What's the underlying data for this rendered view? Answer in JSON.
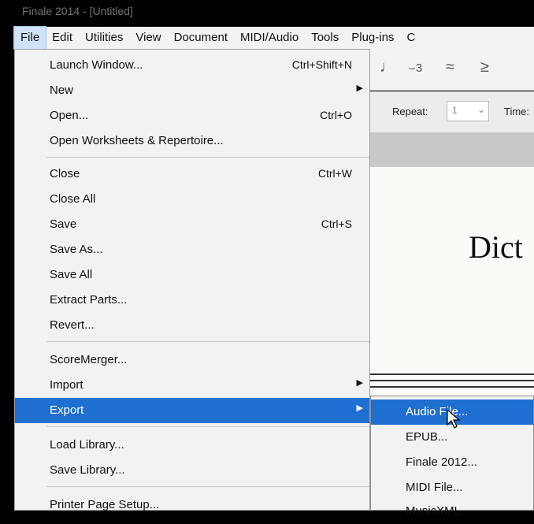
{
  "window": {
    "title": "Finale 2014 - [Untitled]"
  },
  "menubar": {
    "items": [
      "File",
      "Edit",
      "Utilities",
      "View",
      "Document",
      "MIDI/Audio",
      "Tools",
      "Plug-ins",
      "C"
    ]
  },
  "toolbar": {
    "repeat_label": "Repeat:",
    "repeat_value": "1",
    "time_label": "Time:"
  },
  "document": {
    "title_fragment": "Dict"
  },
  "file_menu": {
    "launch_window": {
      "label": "Launch Window...",
      "shortcut": "Ctrl+Shift+N"
    },
    "new": {
      "label": "New"
    },
    "open": {
      "label": "Open...",
      "shortcut": "Ctrl+O"
    },
    "open_worksheets": {
      "label": "Open Worksheets & Repertoire..."
    },
    "close": {
      "label": "Close",
      "shortcut": "Ctrl+W"
    },
    "close_all": {
      "label": "Close All"
    },
    "save": {
      "label": "Save",
      "shortcut": "Ctrl+S"
    },
    "save_as": {
      "label": "Save As..."
    },
    "save_all": {
      "label": "Save All"
    },
    "extract_parts": {
      "label": "Extract Parts..."
    },
    "revert": {
      "label": "Revert..."
    },
    "score_merger": {
      "label": "ScoreMerger..."
    },
    "import": {
      "label": "Import"
    },
    "export": {
      "label": "Export"
    },
    "load_library": {
      "label": "Load Library..."
    },
    "save_library": {
      "label": "Save Library..."
    },
    "printer_page_setup": {
      "label": "Printer Page Setup..."
    }
  },
  "export_submenu": {
    "items": [
      "Audio File...",
      "EPUB...",
      "Finale 2012...",
      "MIDI File...",
      "MusicXML..."
    ]
  },
  "colors": {
    "highlight": "#1f6fd1",
    "menu_bg": "#f2f2f2"
  }
}
